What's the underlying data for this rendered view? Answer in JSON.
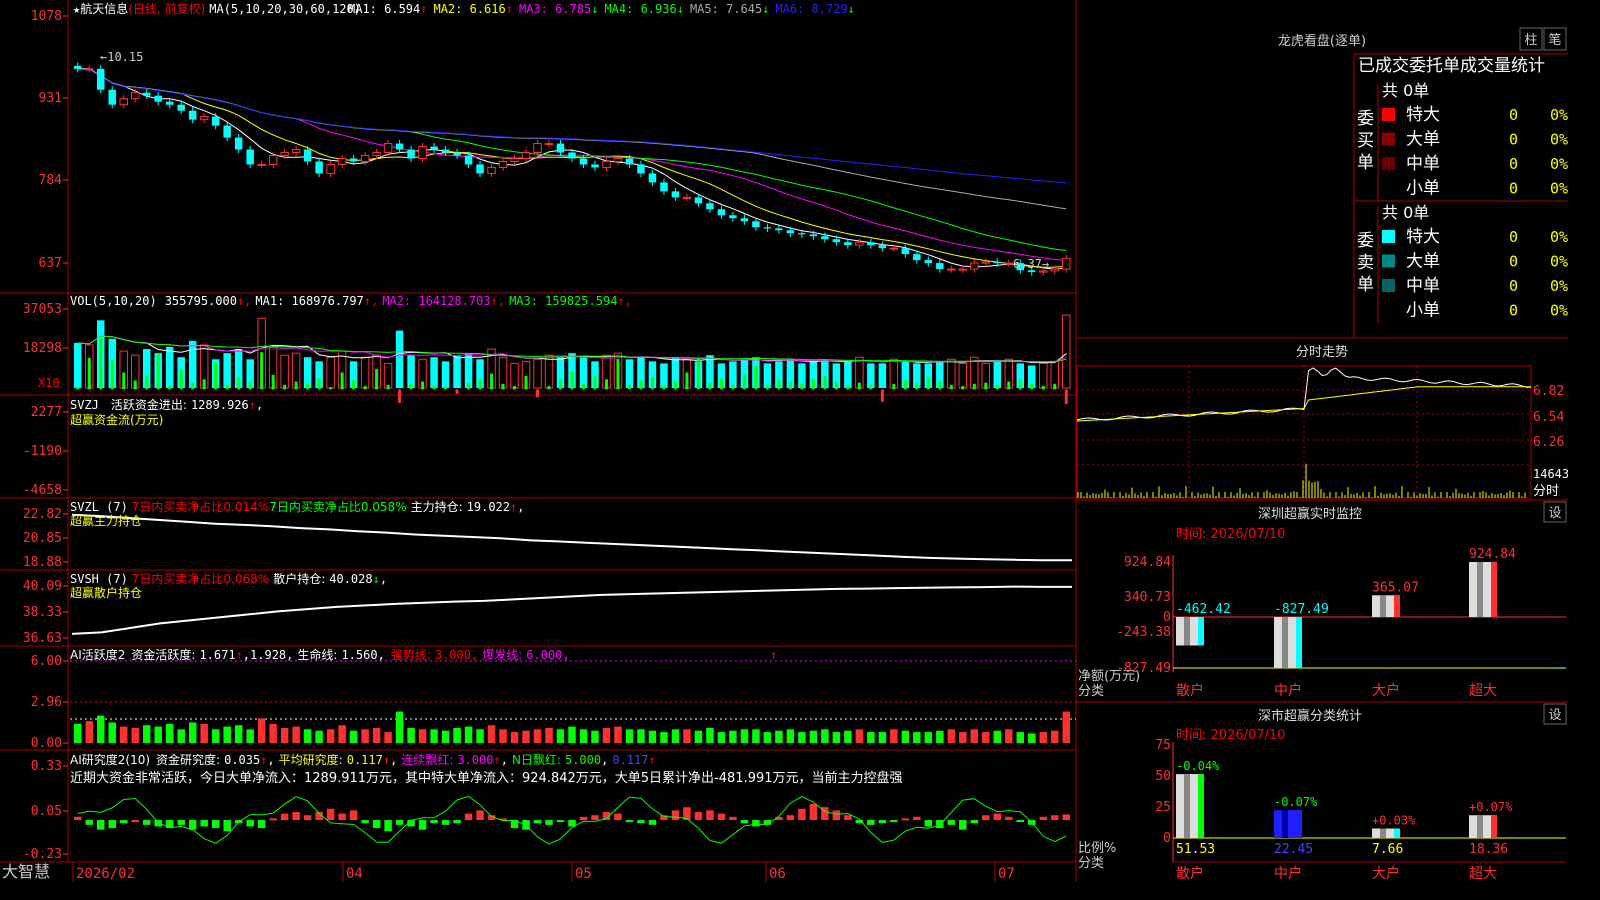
{
  "app_name": "大智慧",
  "stock": {
    "name": "航天信息",
    "mode": "(日线, 前复权)",
    "star": "★"
  },
  "main_panel": {
    "ma_params": "MA(5,10,20,30,60,120)",
    "ma_readouts": [
      {
        "label": "MA1:",
        "value": "6.594",
        "arrow": "↑",
        "color": "#ffffff"
      },
      {
        "label": "MA2:",
        "value": "6.616",
        "arrow": "↑",
        "color": "#ffff00"
      },
      {
        "label": "MA3:",
        "value": "6.785",
        "arrow": "↓",
        "color": "#ff00ff"
      },
      {
        "label": "MA4:",
        "value": "6.936",
        "arrow": "↓",
        "color": "#00ff00"
      },
      {
        "label": "MA5:",
        "value": "7.645",
        "arrow": "↓",
        "color": "#aaaaaa"
      },
      {
        "label": "MA6:",
        "value": "8.729",
        "arrow": "↓",
        "color": "#2222ff"
      }
    ],
    "y_ticks": [
      "1078",
      "931",
      "784",
      "637"
    ],
    "high_label": "←10.15",
    "low_label": "6.37→"
  },
  "vol_panel": {
    "title": "VOL(5,10,20)",
    "value": "355795.000",
    "readouts": [
      {
        "text": "MA1: 168976.797",
        "arrow": "↑",
        "color": "#ffffff"
      },
      {
        "text": "MA2: 164128.703",
        "arrow": "↑",
        "color": "#ff00ff"
      },
      {
        "text": "MA3: 159825.594",
        "arrow": "↑",
        "color": "#00ff00"
      }
    ],
    "y_ticks": [
      "37053",
      "18298"
    ],
    "unit": "X10"
  },
  "svzj_panel": {
    "title": "SVZJ",
    "label": "活跃资金进出:",
    "value": "1289.926",
    "arrow": "↑",
    "subtitle": "超赢资金流(万元)",
    "y_ticks": [
      "2277",
      "-1190",
      "-4658"
    ]
  },
  "svzl_panel": {
    "title": "SVZL (7)",
    "red_text": "7日内买卖净占比0.014%",
    "green_text": "7日内买卖净占比0.058%",
    "label": "主力持仓:",
    "value": "19.022",
    "arrow": "↑",
    "subtitle": "超赢主力持仓",
    "y_ticks": [
      "22.82",
      "20.85",
      "18.88"
    ]
  },
  "svsh_panel": {
    "title": "SVSH (7)",
    "red_text": "7日内买卖净占比0.068%",
    "label": "散户持仓:",
    "value": "40.028",
    "arrow": "↓",
    "subtitle": "超赢散户持仓",
    "y_ticks": [
      "40.09",
      "38.33",
      "36.63"
    ]
  },
  "ai_active_panel": {
    "title": "AI活跃度2",
    "label": "资金活跃度:",
    "value": "1.671",
    "value2": "1.928",
    "life_label": "生命线:",
    "life_value": "1.560",
    "strong_label": "强势线:",
    "strong_value": "3.000",
    "burst_label": "爆发线:",
    "burst_value": "6.000",
    "y_ticks": [
      "6.00",
      "2.96",
      "0.00"
    ]
  },
  "ai_research_panel": {
    "title": "AI研究度2(10)",
    "label": "资金研究度:",
    "value": "0.035",
    "avg_label": "平均研究度:",
    "avg_value": "0.117",
    "streak_label": "连续飘红:",
    "streak_value": "3.000",
    "n_label": "N日飘红:",
    "n_value": "5.000",
    "extra_value": "0.117",
    "comment": "近期大资金非常活跃，今日大单净流入：1289.911万元，其中特大单净流入：924.842万元，大单5日累计净出-481.991万元，当前主力控盘强",
    "y_ticks": [
      "0.33",
      "0.05",
      "-0.23"
    ]
  },
  "x_axis": {
    "labels": [
      "2026/02",
      "04",
      "05",
      "06",
      "07"
    ]
  },
  "dragon_tiger": {
    "title": "龙虎看盘(逐单)",
    "tab_bar": "柱",
    "tab_detail": "笔",
    "header": "已成交委托单成交量统计",
    "buy_side": {
      "label": "委买单",
      "total": "共 0单",
      "rows": [
        {
          "name": "特大",
          "count": "0",
          "pct": "0%",
          "color": "#ff0000"
        },
        {
          "name": "大单",
          "count": "0",
          "pct": "0%",
          "color": "#880000"
        },
        {
          "name": "中单",
          "count": "0",
          "pct": "0%",
          "color": "#660000"
        },
        {
          "name": "小单",
          "count": "0",
          "pct": "0%",
          "color": ""
        }
      ]
    },
    "sell_side": {
      "label": "委卖单",
      "total": "共 0单",
      "rows": [
        {
          "name": "特大",
          "count": "0",
          "pct": "0%",
          "color": "#00ffff"
        },
        {
          "name": "大单",
          "count": "0",
          "pct": "0%",
          "color": "#008888"
        },
        {
          "name": "中单",
          "count": "0",
          "pct": "0%",
          "color": "#006666"
        },
        {
          "name": "小单",
          "count": "0",
          "pct": "0%",
          "color": ""
        }
      ]
    }
  },
  "intraday": {
    "title": "分时走势",
    "y_ticks": [
      "6.82",
      "6.54",
      "6.26"
    ],
    "vol_tick": "14643",
    "vol_label": "分时"
  },
  "sz_monitor": {
    "title": "深圳超赢实时监控",
    "settings": "设",
    "time": "时间: 2026/07/10",
    "y_ticks": [
      "924.84",
      "340.73",
      "0",
      "-243.38",
      "-827.49"
    ],
    "ylabel1": "净额(万元)",
    "ylabel2": "分类",
    "bars": [
      {
        "category": "散户",
        "value": -462.42,
        "label": "-462.42"
      },
      {
        "category": "中户",
        "value": -827.49,
        "label": "-827.49"
      },
      {
        "category": "大户",
        "value": 365.07,
        "label": "365.07"
      },
      {
        "category": "超大",
        "value": 924.84,
        "label": "924.84"
      }
    ]
  },
  "sz_classify": {
    "title": "深市超赢分类统计",
    "settings": "设",
    "time": "时间: 2026/07/10",
    "y_ticks": [
      "75",
      "50",
      "25",
      "0"
    ],
    "ylabel1": "比例%",
    "ylabel2": "分类",
    "bars": [
      {
        "category": "散户",
        "value": 51.53,
        "label": "51.53",
        "change": "-0.04%"
      },
      {
        "category": "中户",
        "value": 22.45,
        "label": "22.45",
        "change": "-0.07%"
      },
      {
        "category": "大户",
        "value": 7.66,
        "label": "7.66",
        "change": "+0.03%"
      },
      {
        "category": "超大",
        "value": 18.36,
        "label": "18.36",
        "change": "+0.07%"
      }
    ]
  },
  "chart_data": [
    {
      "type": "candlestick",
      "title": "航天信息 (日线, 前复权)",
      "ylim": [
        6.2,
        10.8
      ],
      "x_range": [
        "2026/02",
        "2026/07/10"
      ],
      "open": [
        10.0,
        9.95,
        9.95,
        9.6,
        9.35,
        9.45,
        9.55,
        9.5,
        9.4,
        9.35,
        9.25,
        9.1,
        9.15,
        9.0,
        8.8,
        8.6,
        8.35,
        8.35,
        8.5,
        8.55,
        8.6,
        8.4,
        8.2,
        8.35,
        8.45,
        8.4,
        8.5,
        8.55,
        8.7,
        8.6,
        8.45,
        8.65,
        8.6,
        8.55,
        8.5,
        8.35,
        8.2,
        8.3,
        8.4,
        8.45,
        8.55,
        8.7,
        8.7,
        8.55,
        8.45,
        8.35,
        8.3,
        8.4,
        8.45,
        8.35,
        8.2,
        8.05,
        7.9,
        7.8,
        7.8,
        7.7,
        7.6,
        7.5,
        7.45,
        7.4,
        7.3,
        7.28,
        7.25,
        7.2,
        7.18,
        7.15,
        7.1,
        7.05,
        7.0,
        7.05,
        7.0,
        6.95,
        6.95,
        6.85,
        6.75,
        6.7,
        6.6,
        6.6,
        6.6,
        6.7,
        6.72,
        6.7,
        6.7,
        6.58,
        6.55,
        6.57,
        6.6
      ],
      "close": [
        9.95,
        9.95,
        9.6,
        9.35,
        9.45,
        9.55,
        9.5,
        9.4,
        9.35,
        9.25,
        9.1,
        9.15,
        9.0,
        8.8,
        8.6,
        8.35,
        8.35,
        8.5,
        8.55,
        8.6,
        8.4,
        8.2,
        8.35,
        8.45,
        8.4,
        8.5,
        8.55,
        8.7,
        8.6,
        8.45,
        8.65,
        8.6,
        8.55,
        8.5,
        8.35,
        8.2,
        8.3,
        8.4,
        8.45,
        8.55,
        8.7,
        8.7,
        8.55,
        8.45,
        8.35,
        8.3,
        8.4,
        8.45,
        8.35,
        8.2,
        8.05,
        7.9,
        7.8,
        7.8,
        7.7,
        7.6,
        7.5,
        7.45,
        7.4,
        7.3,
        7.28,
        7.25,
        7.2,
        7.18,
        7.15,
        7.1,
        7.05,
        7.0,
        7.05,
        7.0,
        6.95,
        6.95,
        6.85,
        6.75,
        6.7,
        6.6,
        6.6,
        6.6,
        6.7,
        6.72,
        6.7,
        6.7,
        6.58,
        6.55,
        6.57,
        6.6,
        6.78
      ]
    },
    {
      "type": "bar",
      "title": "VOL(5,10,20)",
      "ylim": [
        0,
        40000
      ],
      "values": [
        22000,
        21000,
        33000,
        24000,
        18000,
        16000,
        19000,
        17000,
        20000,
        15000,
        23000,
        21000,
        14000,
        17000,
        19000,
        14000,
        34000,
        20000,
        16000,
        17000,
        15000,
        13000,
        15000,
        18000,
        13000,
        15000,
        16000,
        12000,
        28000,
        16000,
        14000,
        15000,
        13000,
        16000,
        17000,
        14000,
        19000,
        15000,
        12000,
        13000,
        14000,
        16000,
        15000,
        17000,
        15000,
        13000,
        16000,
        17000,
        14000,
        15000,
        13000,
        12000,
        15000,
        14000,
        13000,
        16000,
        12000,
        13000,
        14000,
        15000,
        12000,
        13000,
        14000,
        12000,
        13000,
        14000,
        12000,
        13000,
        15000,
        12000,
        12000,
        14000,
        13000,
        12000,
        12000,
        13000,
        14000,
        12000,
        15000,
        12000,
        13000,
        14000,
        12000,
        11000,
        12000,
        13000,
        35580
      ]
    },
    {
      "type": "bar",
      "title": "SVZJ 超赢资金流(万元)",
      "ylim": [
        -4658,
        2277
      ],
      "values": [
        -200,
        -2800,
        -4500,
        -2600,
        -1500,
        -800,
        -1200,
        -3200,
        -300,
        -1800,
        -600,
        -900,
        -2400,
        -400,
        -1100,
        -700,
        -3300,
        -1300,
        -400,
        -700,
        -500,
        -900,
        -200,
        -1500,
        -800,
        -300,
        -1800,
        -400,
        1200,
        -500,
        -700,
        -300,
        -200,
        400,
        -600,
        -900,
        -1400,
        -500,
        -300,
        -1200,
        700,
        -300,
        -900,
        -1600,
        -500,
        -1200,
        -900,
        -2700,
        -400,
        -800,
        -1100,
        -300,
        -700,
        -1500,
        -2800,
        -600,
        -900,
        -400,
        -1300,
        -2100,
        -300,
        -800,
        -700,
        -500,
        -900,
        -1200,
        -700,
        -300,
        -600,
        -400,
        1100,
        -500,
        -800,
        -600,
        -1100,
        -700,
        -400,
        -300,
        -500,
        -600,
        -400,
        -700,
        -900,
        -500,
        -300,
        -500,
        1290
      ]
    },
    {
      "type": "line",
      "title": "SVZL 超赢主力持仓",
      "ylim": [
        18.88,
        22.82
      ],
      "series": [
        {
          "name": "主力持仓",
          "values": [
            22.6,
            22.5,
            22.35,
            22.2,
            22.05,
            21.9,
            21.8,
            21.7,
            21.55,
            21.45,
            21.3,
            21.2,
            21.05,
            20.95,
            20.85,
            20.75,
            20.6,
            20.5,
            20.4,
            20.3,
            20.2,
            20.1,
            20.0,
            19.9,
            19.8,
            19.7,
            19.6,
            19.5,
            19.4,
            19.3,
            19.2,
            19.15,
            19.1,
            19.05,
            19.02,
            19.02
          ]
        }
      ]
    },
    {
      "type": "line",
      "title": "SVSH 超赢散户持仓",
      "ylim": [
        36.63,
        40.09
      ],
      "series": [
        {
          "name": "散户持仓",
          "values": [
            36.9,
            37.0,
            37.3,
            37.6,
            37.8,
            38.0,
            38.2,
            38.4,
            38.55,
            38.7,
            38.8,
            38.9,
            38.98,
            39.05,
            39.1,
            39.2,
            39.3,
            39.4,
            39.5,
            39.55,
            39.6,
            39.65,
            39.7,
            39.75,
            39.8,
            39.85,
            39.9,
            39.92,
            39.95,
            39.98,
            40.0,
            40.02,
            40.05,
            40.03,
            40.028
          ]
        }
      ]
    },
    {
      "type": "bar",
      "title": "AI活跃度2",
      "ylim": [
        0,
        6.0
      ],
      "values": [
        1.4,
        1.6,
        2.0,
        1.5,
        1.2,
        1.1,
        1.3,
        1.2,
        1.4,
        1.0,
        1.5,
        1.4,
        1.0,
        1.2,
        1.3,
        1.0,
        1.8,
        1.4,
        1.1,
        1.2,
        1.0,
        0.9,
        1.0,
        1.3,
        0.9,
        1.0,
        1.1,
        0.8,
        2.3,
        1.1,
        1.0,
        1.0,
        0.9,
        1.1,
        1.2,
        1.0,
        1.3,
        1.0,
        0.8,
        0.9,
        1.0,
        1.1,
        1.0,
        1.2,
        1.0,
        0.9,
        1.1,
        1.2,
        1.0,
        1.0,
        0.9,
        0.8,
        1.0,
        1.0,
        0.9,
        1.1,
        0.8,
        0.9,
        1.0,
        1.0,
        0.8,
        0.9,
        1.0,
        0.8,
        0.9,
        1.0,
        0.8,
        0.9,
        1.0,
        0.8,
        0.8,
        1.0,
        0.9,
        0.8,
        0.8,
        0.9,
        1.0,
        0.8,
        1.0,
        0.8,
        0.9,
        1.0,
        0.8,
        0.7,
        0.8,
        0.9,
        2.3
      ]
    },
    {
      "type": "bar",
      "title": "AI研究度2(10)",
      "ylim": [
        -0.23,
        0.33
      ],
      "values": [
        0.02,
        -0.03,
        -0.06,
        -0.05,
        -0.02,
        0.0,
        -0.03,
        -0.04,
        -0.05,
        -0.03,
        -0.06,
        -0.04,
        -0.05,
        -0.07,
        -0.02,
        -0.04,
        -0.05,
        0.01,
        0.04,
        0.05,
        0.03,
        0.05,
        0.07,
        0.04,
        0.06,
        -0.02,
        -0.05,
        -0.07,
        -0.03,
        -0.04,
        -0.06,
        -0.02,
        -0.03,
        -0.02,
        0.04,
        0.06,
        0.03,
        0.01,
        -0.05,
        -0.06,
        -0.02,
        -0.03,
        -0.01,
        -0.04,
        0.02,
        0.03,
        0.05,
        0.04,
        -0.01,
        -0.02,
        -0.03,
        0.03,
        0.06,
        0.08,
        0.05,
        0.06,
        0.04,
        0.02,
        -0.02,
        -0.04,
        -0.03,
        0.02,
        0.03,
        0.07,
        0.1,
        0.08,
        0.06,
        0.03,
        -0.02,
        -0.03,
        -0.02,
        -0.01,
        0.01,
        0.02,
        -0.04,
        -0.05,
        -0.03,
        -0.06,
        -0.02,
        0.03,
        0.04,
        0.02,
        -0.01,
        -0.03,
        0.02,
        0.03,
        0.035
      ]
    },
    {
      "type": "bar",
      "title": "深圳超赢实时监控",
      "categories": [
        "散户",
        "中户",
        "大户",
        "超大"
      ],
      "values": [
        -462.42,
        -827.49,
        365.07,
        924.84
      ],
      "ylabel": "净额(万元)",
      "xlabel": "分类"
    },
    {
      "type": "bar",
      "title": "深市超赢分类统计",
      "categories": [
        "散户",
        "中户",
        "大户",
        "超大"
      ],
      "values": [
        51.53,
        22.45,
        7.66,
        18.36
      ],
      "ylim": [
        0,
        75
      ],
      "ylabel": "比例%",
      "xlabel": "分类"
    }
  ]
}
